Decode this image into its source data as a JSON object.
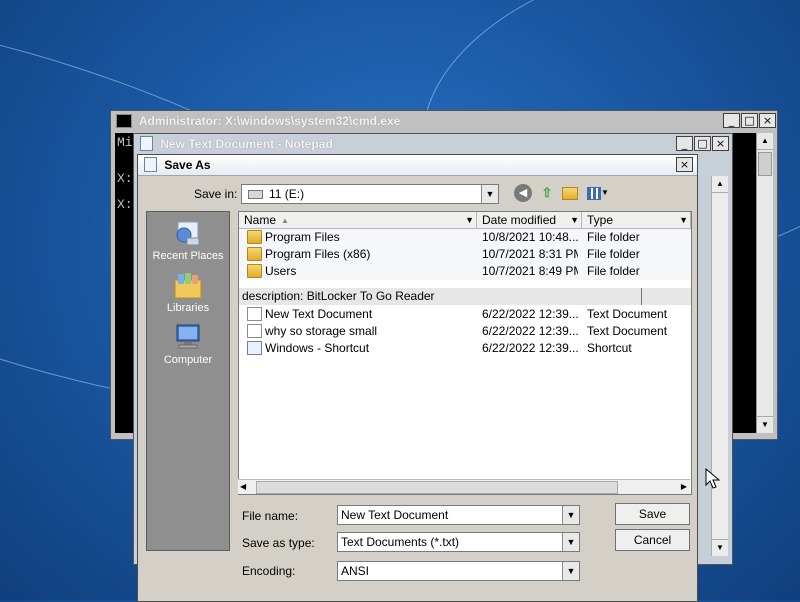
{
  "desktop": {},
  "cmd": {
    "title": "Administrator: X:\\windows\\system32\\cmd.exe",
    "lines": [
      "Mi",
      "X:",
      "X:"
    ],
    "buttons": {
      "minimize": "_",
      "maximize": "□",
      "close": "×"
    }
  },
  "notepad": {
    "title": "New Text Document - Notepad",
    "buttons": {
      "minimize": "_",
      "maximize": "□",
      "close": "×"
    }
  },
  "saveas": {
    "title": "Save As",
    "close": "×",
    "save_in_label": "Save in:",
    "save_in_value": "11 (E:)",
    "places": [
      {
        "label": "Recent Places",
        "icon": "recent-places-icon"
      },
      {
        "label": "Libraries",
        "icon": "libraries-icon"
      },
      {
        "label": "Computer",
        "icon": "computer-icon"
      }
    ],
    "columns": {
      "name": "Name",
      "date": "Date modified",
      "type": "Type"
    },
    "folders": [
      {
        "name": "Program Files",
        "date": "10/8/2021 10:48...",
        "type": "File folder"
      },
      {
        "name": "Program Files (x86)",
        "date": "10/7/2021 8:31 PM",
        "type": "File folder"
      },
      {
        "name": "Users",
        "date": "10/7/2021 8:49 PM",
        "type": "File folder"
      }
    ],
    "group_header": "description: BitLocker To Go Reader",
    "files": [
      {
        "name": "New Text Document",
        "date": "6/22/2022 12:39...",
        "type": "Text Document",
        "icon": "text-document-icon"
      },
      {
        "name": "why so storage small",
        "date": "6/22/2022 12:39...",
        "type": "Text Document",
        "icon": "text-document-icon"
      },
      {
        "name": "Windows - Shortcut",
        "date": "6/22/2022 12:39...",
        "type": "Shortcut",
        "icon": "shortcut-icon"
      }
    ],
    "file_name_label": "File name:",
    "file_name_value": "New Text Document",
    "type_label": "Save as type:",
    "type_value": "Text Documents (*.txt)",
    "encoding_label": "Encoding:",
    "encoding_value": "ANSI",
    "save_button": "Save",
    "cancel_button": "Cancel"
  }
}
